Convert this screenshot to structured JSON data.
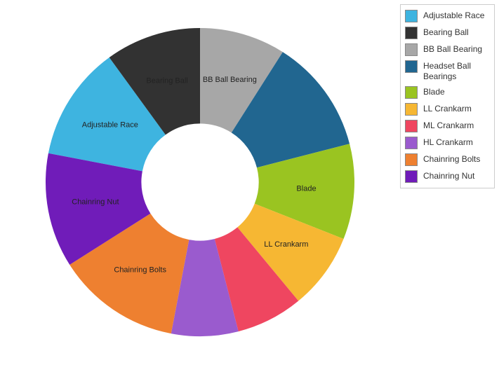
{
  "chart_data": {
    "type": "pie",
    "inner_radius_ratio": 0.38,
    "series": [
      {
        "name": "Adjustable Race",
        "value": 12,
        "color": "#3eb4e0",
        "show_label": true
      },
      {
        "name": "Bearing Ball",
        "value": 10,
        "color": "#323232",
        "show_label": true
      },
      {
        "name": "BB Ball Bearing",
        "value": 9,
        "color": "#a7a7a7",
        "show_label": true
      },
      {
        "name": "Headset Ball Bearings",
        "value": 12,
        "color": "#216690",
        "show_label": false
      },
      {
        "name": "Blade",
        "value": 10,
        "color": "#9ac421",
        "show_label": true
      },
      {
        "name": "LL Crankarm",
        "value": 8,
        "color": "#f6b733",
        "show_label": true
      },
      {
        "name": "ML Crankarm",
        "value": 7,
        "color": "#ef4660",
        "show_label": false
      },
      {
        "name": "HL Crankarm",
        "value": 7,
        "color": "#9a5bce",
        "show_label": false
      },
      {
        "name": "Chainring Bolts",
        "value": 13,
        "color": "#ee8030",
        "show_label": true
      },
      {
        "name": "Chainring Nut",
        "value": 12,
        "color": "#701cb9",
        "show_label": true
      }
    ]
  },
  "legend": {
    "items": [
      {
        "label": "Adjustable Race",
        "color": "#3eb4e0"
      },
      {
        "label": "Bearing Ball",
        "color": "#323232"
      },
      {
        "label": "BB Ball Bearing",
        "color": "#a7a7a7"
      },
      {
        "label": "Headset Ball Bearings",
        "color": "#216690"
      },
      {
        "label": "Blade",
        "color": "#9ac421"
      },
      {
        "label": "LL Crankarm",
        "color": "#f6b733"
      },
      {
        "label": "ML Crankarm",
        "color": "#ef4660"
      },
      {
        "label": "HL Crankarm",
        "color": "#9a5bce"
      },
      {
        "label": "Chainring Bolts",
        "color": "#ee8030"
      },
      {
        "label": "Chainring Nut",
        "color": "#701cb9"
      }
    ]
  }
}
